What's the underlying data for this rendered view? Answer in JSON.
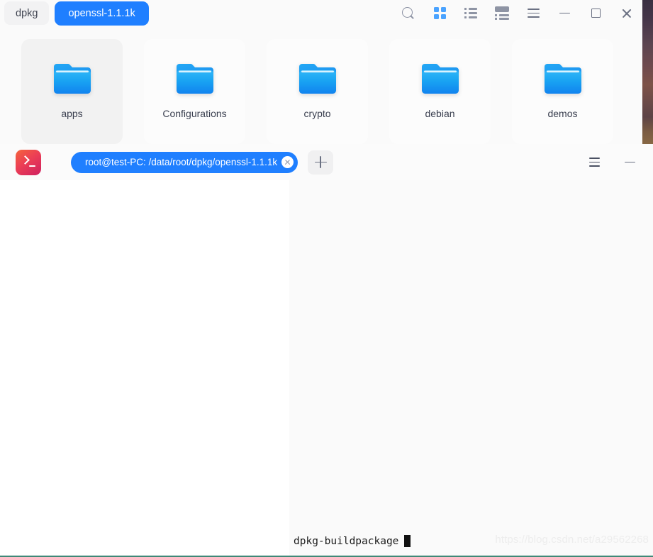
{
  "file_manager": {
    "tabs": [
      {
        "label": "dpkg",
        "active": false
      },
      {
        "label": "openssl-1.1.1k",
        "active": true
      }
    ],
    "toolbar": [
      {
        "name": "search-icon",
        "label": "Search"
      },
      {
        "name": "grid-view-icon",
        "label": "Icon view"
      },
      {
        "name": "list-view-icon",
        "label": "List view"
      },
      {
        "name": "detail-view-icon",
        "label": "Detail view"
      },
      {
        "name": "menu-icon",
        "label": "Menu"
      },
      {
        "name": "minimize-icon",
        "label": "Minimize"
      },
      {
        "name": "maximize-icon",
        "label": "Maximize"
      },
      {
        "name": "close-icon",
        "label": "Close"
      }
    ],
    "folders": [
      {
        "name": "apps",
        "selected": true
      },
      {
        "name": "Configurations",
        "selected": false
      },
      {
        "name": "crypto",
        "selected": false
      },
      {
        "name": "debian",
        "selected": false
      },
      {
        "name": "demos",
        "selected": false
      }
    ]
  },
  "terminal": {
    "app_icon": "terminal-icon",
    "tab_title": "root@test-PC: /data/root/dpkg/openssl-1.1.1k",
    "new_tab_label": "+",
    "controls": [
      {
        "name": "menu-icon",
        "label": "Menu"
      },
      {
        "name": "minimize-icon",
        "label": "Minimize"
      }
    ],
    "command": "dpkg-buildpackage",
    "watermark": "https://blog.csdn.net/a29562268"
  },
  "colors": {
    "accent_blue": "#1f7fff",
    "folder_blue": "#1f9cf0",
    "terminal_red": "#ec3f55",
    "bottom_border": "#3f8877"
  }
}
